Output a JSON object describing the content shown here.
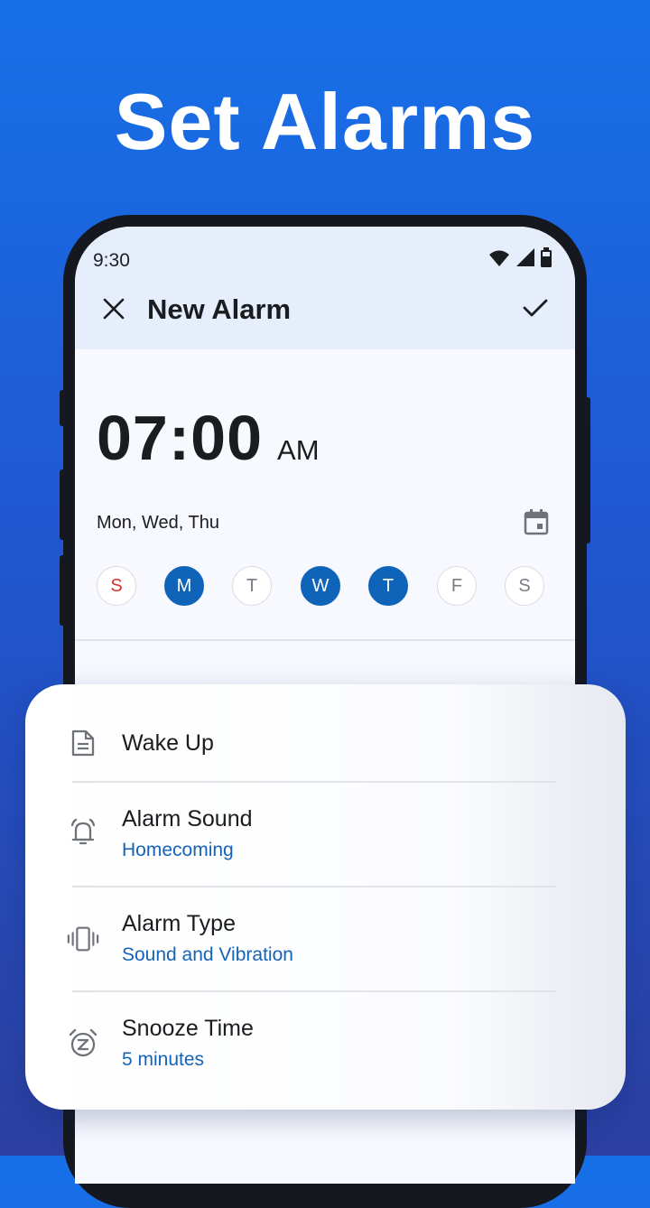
{
  "banner": {
    "headline": "Set Alarms"
  },
  "status_bar": {
    "time": "9:30",
    "icons": [
      "wifi-icon",
      "signal-icon",
      "battery-icon"
    ]
  },
  "app_bar": {
    "title": "New Alarm",
    "close_icon": "close-icon",
    "confirm_icon": "check-icon"
  },
  "alarm": {
    "time": "07:00",
    "period": "AM",
    "days_summary": "Mon, Wed, Thu",
    "calendar_icon": "calendar-icon",
    "days": [
      {
        "label": "S",
        "selected": false
      },
      {
        "label": "M",
        "selected": true
      },
      {
        "label": "T",
        "selected": false
      },
      {
        "label": "W",
        "selected": true
      },
      {
        "label": "T",
        "selected": true
      },
      {
        "label": "F",
        "selected": false
      },
      {
        "label": "S",
        "selected": false
      }
    ]
  },
  "settings": [
    {
      "icon": "document-icon",
      "label": "Wake Up",
      "value": ""
    },
    {
      "icon": "bell-icon",
      "label": "Alarm Sound",
      "value": "Homecoming"
    },
    {
      "icon": "vibration-icon",
      "label": "Alarm Type",
      "value": "Sound and Vibration"
    },
    {
      "icon": "snooze-icon",
      "label": "Snooze Time",
      "value": "5 minutes"
    }
  ],
  "colors": {
    "accent": "#0f64b9",
    "link": "#1463b8",
    "sunday": "#d6322e",
    "background_top": "#1770e8",
    "background_bottom": "#2c3fa0"
  }
}
